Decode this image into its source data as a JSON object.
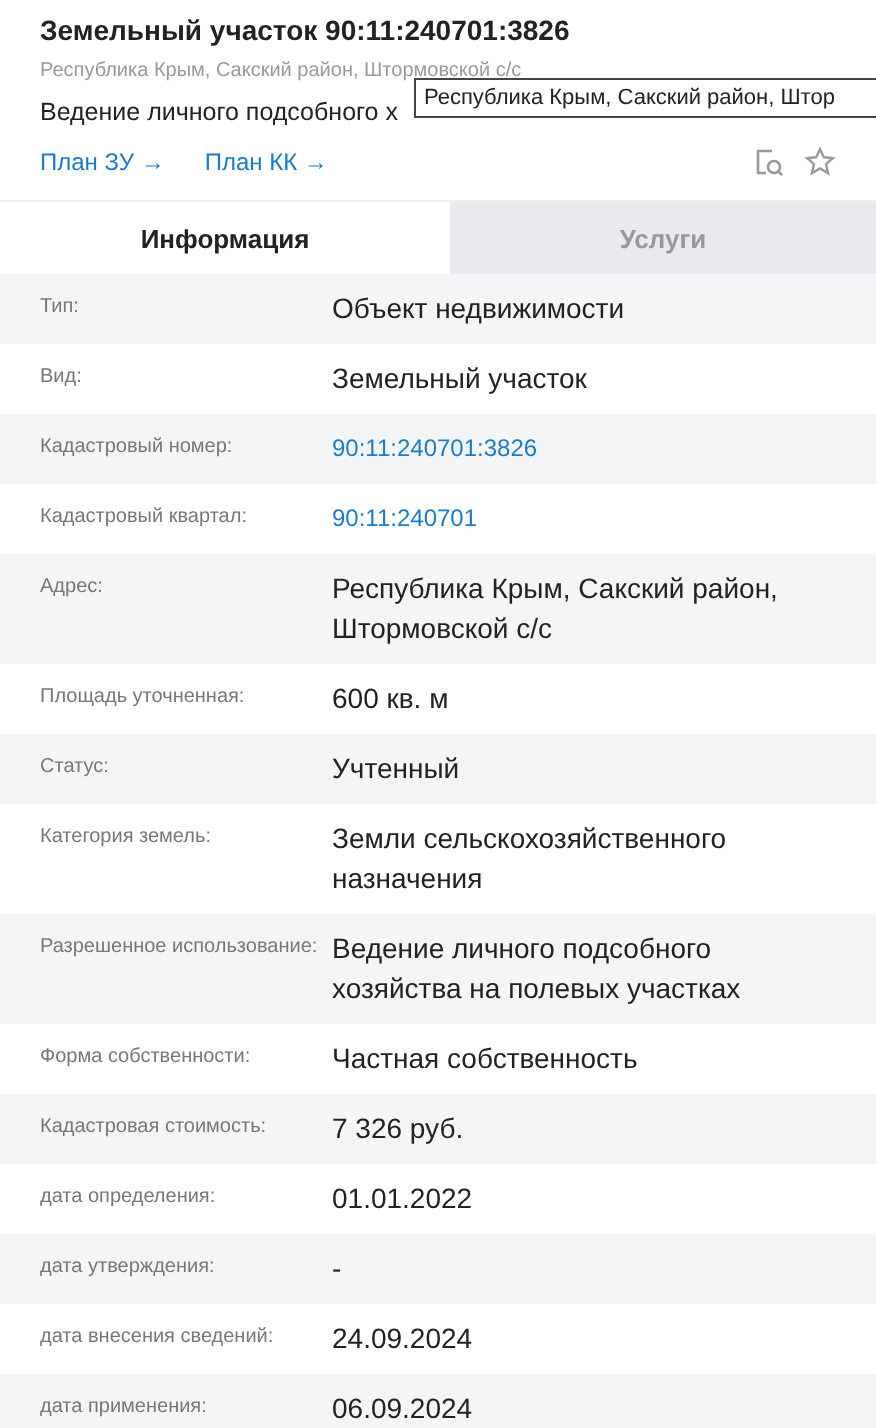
{
  "header": {
    "title": "Земельный участок 90:11:240701:3826",
    "address": "Республика Крым, Сакский район, Штормовской с/с",
    "description": "Ведение личного подсобного х",
    "links": [
      {
        "label": "План ЗУ →"
      },
      {
        "label": "План КК →"
      }
    ]
  },
  "tooltip": {
    "text": "Республика Крым, Сакский район, Штор"
  },
  "tabs": [
    {
      "label": "Информация",
      "selected": true
    },
    {
      "label": "Услуги",
      "selected": false
    }
  ],
  "rows": [
    {
      "label": "Тип:",
      "value": "Объект недвижимости",
      "kind": "text"
    },
    {
      "label": "Вид:",
      "value": "Земельный участок",
      "kind": "text"
    },
    {
      "label": "Кадастровый номер:",
      "value": "90:11:240701:3826",
      "kind": "link"
    },
    {
      "label": "Кадастровый квартал:",
      "value": "90:11:240701",
      "kind": "link"
    },
    {
      "label": "Адрес:",
      "value": "Республика Крым, Сакский район, Штормовской с/с",
      "kind": "text"
    },
    {
      "label": "Площадь уточненная:",
      "value": "600 кв. м",
      "kind": "text"
    },
    {
      "label": "Статус:",
      "value": "Учтенный",
      "kind": "text"
    },
    {
      "label": "Категория земель:",
      "value": "Земли сельскохозяйственного назначения",
      "kind": "text"
    },
    {
      "label": "Разрешенное использование:",
      "value": "Ведение личного подсобного хозяйства на полевых участках",
      "kind": "text"
    },
    {
      "label": "Форма собственности:",
      "value": "Частная собственность",
      "kind": "text"
    },
    {
      "label": "Кадастровая стоимость:",
      "value": "7 326 руб.",
      "kind": "text"
    },
    {
      "label": "дата определения:",
      "value": "01.01.2022",
      "kind": "text"
    },
    {
      "label": "дата утверждения:",
      "value": "-",
      "kind": "text"
    },
    {
      "label": "дата внесения сведений:",
      "value": "24.09.2024",
      "kind": "text"
    },
    {
      "label": "дата применения:",
      "value": "06.09.2024",
      "kind": "text"
    }
  ]
}
